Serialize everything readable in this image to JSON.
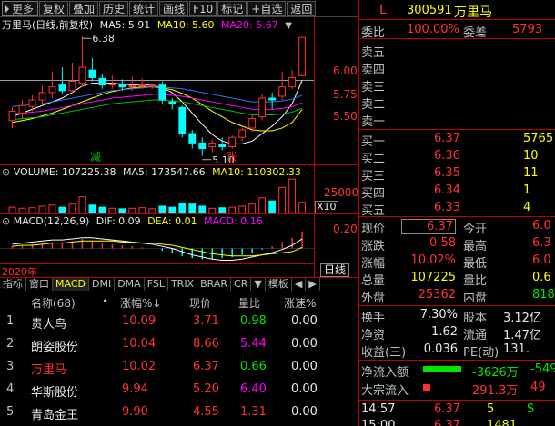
{
  "toolbar": {
    "more": "更多",
    "items": [
      "复权",
      "叠加",
      "历史",
      "统计",
      "画线",
      "F10",
      "标记",
      "+自选",
      "返回"
    ]
  },
  "chart": {
    "title": "万里马(日线,前复权)",
    "ma5_label": "MA5: 5.91",
    "ma10_label": "MA10: 5.60",
    "ma20_label": "MA20: 5.67",
    "high_label": "6.38",
    "low_label": "5.10",
    "y_ticks": [
      "6.00",
      "5.75",
      "5.50"
    ],
    "mark_jian": "减",
    "mark_zhang": "涨",
    "candles": [
      {
        "o": 5.48,
        "c": 5.58,
        "h": 5.62,
        "l": 5.4
      },
      {
        "o": 5.56,
        "c": 5.64,
        "h": 5.7,
        "l": 5.5
      },
      {
        "o": 5.63,
        "c": 5.7,
        "h": 5.75,
        "l": 5.58
      },
      {
        "o": 5.7,
        "c": 5.78,
        "h": 5.85,
        "l": 5.64
      },
      {
        "o": 5.78,
        "c": 5.84,
        "h": 6.0,
        "l": 5.72
      },
      {
        "o": 5.86,
        "c": 5.8,
        "h": 6.05,
        "l": 5.76
      },
      {
        "o": 5.8,
        "c": 5.9,
        "h": 6.1,
        "l": 5.76
      },
      {
        "o": 5.88,
        "c": 6.05,
        "h": 6.38,
        "l": 5.84
      },
      {
        "o": 6.02,
        "c": 5.94,
        "h": 6.15,
        "l": 5.9
      },
      {
        "o": 5.93,
        "c": 5.86,
        "h": 5.98,
        "l": 5.82
      },
      {
        "o": 5.86,
        "c": 5.87,
        "h": 5.96,
        "l": 5.82
      },
      {
        "o": 5.87,
        "c": 5.84,
        "h": 5.92,
        "l": 5.8
      },
      {
        "o": 5.84,
        "c": 5.85,
        "h": 5.95,
        "l": 5.8
      },
      {
        "o": 5.86,
        "c": 5.86,
        "h": 5.93,
        "l": 5.82
      },
      {
        "o": 5.85,
        "c": 5.86,
        "h": 5.88,
        "l": 5.82
      },
      {
        "o": 5.86,
        "c": 5.7,
        "h": 5.9,
        "l": 5.66
      },
      {
        "o": 5.68,
        "c": 5.66,
        "h": 5.72,
        "l": 5.6
      },
      {
        "o": 5.62,
        "c": 5.34,
        "h": 5.64,
        "l": 5.3
      },
      {
        "o": 5.34,
        "c": 5.24,
        "h": 5.38,
        "l": 5.18
      },
      {
        "o": 5.24,
        "c": 5.18,
        "h": 5.3,
        "l": 5.1
      },
      {
        "o": 5.2,
        "c": 5.24,
        "h": 5.28,
        "l": 5.14
      },
      {
        "o": 5.22,
        "c": 5.2,
        "h": 5.3,
        "l": 5.16
      },
      {
        "o": 5.2,
        "c": 5.3,
        "h": 5.32,
        "l": 5.18
      },
      {
        "o": 5.3,
        "c": 5.38,
        "h": 5.4,
        "l": 5.26
      },
      {
        "o": 5.4,
        "c": 5.5,
        "h": 5.54,
        "l": 5.36
      },
      {
        "o": 5.52,
        "c": 5.72,
        "h": 5.76,
        "l": 5.48
      },
      {
        "o": 5.72,
        "c": 5.7,
        "h": 5.78,
        "l": 5.6
      },
      {
        "o": 5.74,
        "c": 5.84,
        "h": 6.0,
        "l": 5.7
      },
      {
        "o": 5.84,
        "c": 5.94,
        "h": 6.02,
        "l": 5.82
      },
      {
        "o": 5.96,
        "c": 6.37,
        "h": 6.37,
        "l": 5.96
      }
    ],
    "ma5": [
      5.52,
      5.56,
      5.6,
      5.64,
      5.68,
      5.72,
      5.78,
      5.85,
      5.88,
      5.88,
      5.88,
      5.87,
      5.86,
      5.86,
      5.86,
      5.83,
      5.78,
      5.68,
      5.56,
      5.44,
      5.33,
      5.26,
      5.23,
      5.23,
      5.26,
      5.34,
      5.42,
      5.52,
      5.66,
      5.91
    ],
    "ma10": [
      5.46,
      5.48,
      5.5,
      5.53,
      5.56,
      5.6,
      5.64,
      5.68,
      5.72,
      5.76,
      5.79,
      5.81,
      5.83,
      5.84,
      5.84,
      5.83,
      5.81,
      5.77,
      5.72,
      5.65,
      5.58,
      5.52,
      5.46,
      5.42,
      5.38,
      5.37,
      5.37,
      5.4,
      5.46,
      5.6
    ],
    "ma20": [
      5.55,
      5.56,
      5.57,
      5.58,
      5.6,
      5.62,
      5.64,
      5.66,
      5.68,
      5.7,
      5.72,
      5.73,
      5.74,
      5.75,
      5.76,
      5.76,
      5.75,
      5.74,
      5.72,
      5.7,
      5.68,
      5.66,
      5.64,
      5.62,
      5.6,
      5.6,
      5.6,
      5.61,
      5.63,
      5.67
    ]
  },
  "volume": {
    "label": "VOLUME: 107225.38",
    "ma5_label": "MA5: 173547.66",
    "ma10_label": "MA10: 110302.33",
    "tick": "25000",
    "x10": "X10",
    "values": [
      60000,
      50000,
      55000,
      70000,
      80000,
      60000,
      90000,
      160000,
      80000,
      60000,
      50000,
      45000,
      50000,
      55000,
      45000,
      70000,
      60000,
      100000,
      90000,
      70000,
      50000,
      55000,
      60000,
      70000,
      90000,
      150000,
      120000,
      250000,
      330000,
      107225
    ]
  },
  "macd": {
    "label": "MACD(12,26,9)",
    "dif_label": "DIF: 0.09",
    "dea_label": "DEA: 0.01",
    "macd_label": "MACD: 0.16",
    "tick": "0.20",
    "bars": [
      0.02,
      0.03,
      0.04,
      0.05,
      0.06,
      0.06,
      0.07,
      0.09,
      0.07,
      0.05,
      0.04,
      0.03,
      0.02,
      0.01,
      0.0,
      -0.02,
      -0.04,
      -0.07,
      -0.09,
      -0.1,
      -0.1,
      -0.09,
      -0.08,
      -0.06,
      -0.04,
      -0.01,
      0.02,
      0.06,
      0.1,
      0.16
    ],
    "dif": [
      0.04,
      0.05,
      0.06,
      0.07,
      0.08,
      0.08,
      0.09,
      0.1,
      0.1,
      0.09,
      0.08,
      0.07,
      0.06,
      0.05,
      0.04,
      0.02,
      0.0,
      -0.03,
      -0.06,
      -0.08,
      -0.1,
      -0.11,
      -0.11,
      -0.1,
      -0.08,
      -0.06,
      -0.04,
      -0.01,
      0.03,
      0.09
    ],
    "dea": [
      0.02,
      0.03,
      0.03,
      0.04,
      0.05,
      0.05,
      0.06,
      0.07,
      0.07,
      0.07,
      0.07,
      0.06,
      0.06,
      0.05,
      0.05,
      0.04,
      0.03,
      0.01,
      -0.01,
      -0.03,
      -0.05,
      -0.06,
      -0.07,
      -0.07,
      -0.07,
      -0.06,
      -0.05,
      -0.04,
      -0.03,
      0.01
    ]
  },
  "year_label": "2020年",
  "period_label": "日线",
  "tabs": [
    "指标",
    "窗口",
    "MACD",
    "DMI",
    "DMA",
    "FSL",
    "TRIX",
    "BRAR",
    "CR",
    "▼",
    "模板",
    "◀",
    "▶"
  ],
  "table": {
    "headers": [
      "名称(68)",
      "•",
      "涨幅%↓",
      "现价",
      "量比",
      "涨速%"
    ],
    "rows": [
      {
        "idx": "1",
        "name": "贵人鸟",
        "chg": "10.09",
        "price": "3.71",
        "vr": "0.98",
        "spd": "0.00",
        "vr_color": "grn",
        "name_color": "wht"
      },
      {
        "idx": "2",
        "name": "朗姿股份",
        "chg": "10.04",
        "price": "8.66",
        "vr": "5.44",
        "spd": "0.00",
        "vr_color": "mag",
        "name_color": "wht"
      },
      {
        "idx": "3",
        "name": "万里马",
        "chg": "10.02",
        "price": "6.37",
        "vr": "0.66",
        "spd": "0.00",
        "vr_color": "grn",
        "name_color": "red"
      },
      {
        "idx": "4",
        "name": "华斯股份",
        "chg": "9.94",
        "price": "5.20",
        "vr": "6.40",
        "spd": "0.00",
        "vr_color": "mag",
        "name_color": "wht"
      },
      {
        "idx": "5",
        "name": "青岛金王",
        "chg": "9.90",
        "price": "4.55",
        "vr": "1.31",
        "spd": "0.00",
        "vr_color": "red",
        "name_color": "wht"
      }
    ]
  },
  "right": {
    "badge": "L",
    "code": "300591",
    "name": "万里马",
    "weibi_label": "委比",
    "weibi_val": "100.00%",
    "weicha_label": "委差",
    "weicha_val": "5793",
    "sell": [
      {
        "label": "卖五"
      },
      {
        "label": "卖四"
      },
      {
        "label": "卖三"
      },
      {
        "label": "卖二"
      },
      {
        "label": "卖一"
      }
    ],
    "buy": [
      {
        "label": "买一",
        "price": "6.37",
        "vol": "5765"
      },
      {
        "label": "买二",
        "price": "6.36",
        "vol": "10"
      },
      {
        "label": "买三",
        "price": "6.35",
        "vol": "11"
      },
      {
        "label": "买四",
        "price": "6.34",
        "vol": "1"
      },
      {
        "label": "买五",
        "price": "6.33",
        "vol": "4"
      }
    ],
    "stats": [
      {
        "l1": "现价",
        "v1": "6.37",
        "l2": "今开",
        "v2": "6.0",
        "c1": "red",
        "c2": "red"
      },
      {
        "l1": "涨跌",
        "v1": "0.58",
        "l2": "最高",
        "v2": "6.3",
        "c1": "red",
        "c2": "red"
      },
      {
        "l1": "涨幅",
        "v1": "10.02%",
        "l2": "最低",
        "v2": "6.0",
        "c1": "red",
        "c2": "red"
      },
      {
        "l1": "总量",
        "v1": "107225",
        "l2": "量比",
        "v2": "0.6",
        "c1": "yel",
        "c2": "yel"
      },
      {
        "l1": "外盘",
        "v1": "25362",
        "l2": "内盘",
        "v2": "8186",
        "c1": "red",
        "c2": "grn"
      }
    ],
    "stats2": [
      {
        "l1": "换手",
        "v1": "7.30%",
        "l2": "股本",
        "v2": "3.12亿"
      },
      {
        "l1": "净资",
        "v1": "1.62",
        "l2": "流通",
        "v2": "1.47亿"
      },
      {
        "l1": "收益(三)",
        "v1": "0.036",
        "l2": "PE(动)",
        "v2": "131."
      }
    ],
    "flow": [
      {
        "label": "净流入额",
        "v1": "-3626万",
        "v2": "-549"
      },
      {
        "label": "大宗流入",
        "v1": "291.3万",
        "v2": "49"
      }
    ],
    "ticks": [
      {
        "time": "14:57",
        "price": "6.37",
        "vol": "5",
        "flag": "S"
      },
      {
        "time": "15:00",
        "price": "6.37",
        "vol": "1481",
        "flag": ""
      }
    ]
  }
}
